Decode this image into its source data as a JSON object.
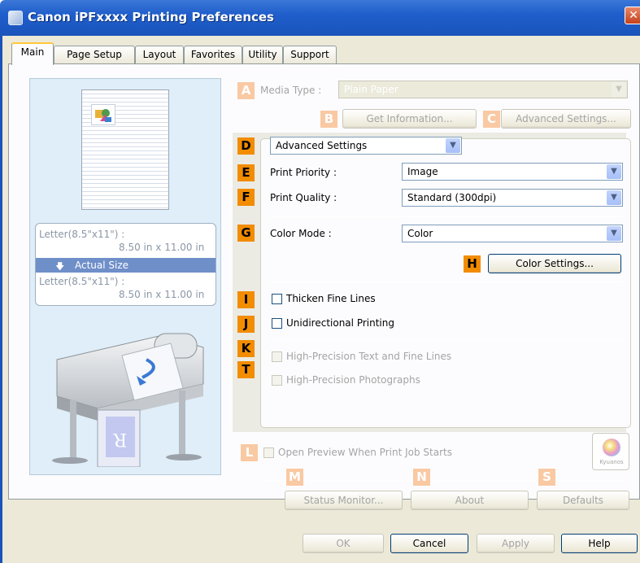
{
  "window": {
    "title": "Canon iPFxxxx Printing Preferences",
    "close": "✕"
  },
  "tabs": [
    "Main",
    "Page Setup",
    "Layout",
    "Favorites",
    "Utility",
    "Support"
  ],
  "preview": {
    "size_top_line1": "Letter(8.5\"x11\") :",
    "size_top_line2": "8.50 in x 11.00 in",
    "actual_size": "Actual Size",
    "size_bottom_line1": "Letter(8.5\"x11\") :",
    "size_bottom_line2": "8.50 in x 11.00 in",
    "arrow": "🡇",
    "print_letter": "R"
  },
  "markers": {
    "A": "A",
    "B": "B",
    "C": "C",
    "D": "D",
    "E": "E",
    "F": "F",
    "G": "G",
    "H": "H",
    "I": "I",
    "J": "J",
    "K": "K",
    "T": "T",
    "L": "L",
    "M": "M",
    "N": "N",
    "S": "S"
  },
  "media": {
    "label": "Media Type :",
    "value": "Plain Paper"
  },
  "buttons": {
    "get_info": "Get Information...",
    "advanced": "Advanced Settings...",
    "color_settings": "Color Settings...",
    "status_monitor": "Status Monitor...",
    "about": "About",
    "defaults": "Defaults",
    "ok": "OK",
    "cancel": "Cancel",
    "apply": "Apply",
    "help": "Help"
  },
  "mode": {
    "value": "Advanced Settings"
  },
  "print_priority": {
    "label": "Print Priority :",
    "value": "Image"
  },
  "print_quality": {
    "label": "Print Quality :",
    "value": "Standard (300dpi)"
  },
  "color_mode": {
    "label": "Color Mode :",
    "value": "Color"
  },
  "checks": {
    "thicken": "Thicken Fine Lines",
    "unidirectional": "Unidirectional Printing",
    "hp_text": "High-Precision Text and Fine Lines",
    "hp_photo": "High-Precision Photographs",
    "open_preview": "Open Preview When Print Job Starts"
  },
  "kyuanos": "Kyuanos",
  "colors": {
    "marker_on": "#f28c00",
    "marker_off": "#f9c9a3",
    "title_bar": "#1f5ecb"
  }
}
